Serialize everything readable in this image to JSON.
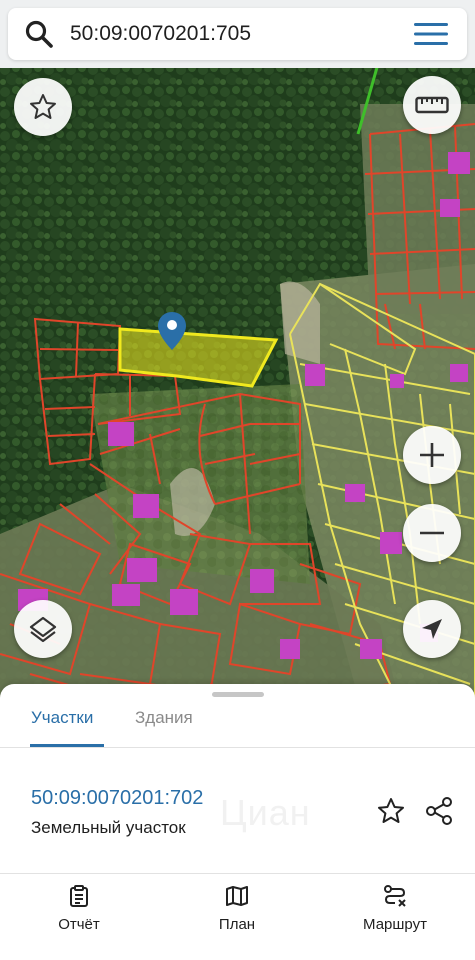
{
  "search": {
    "value": "50:09:0070201:705",
    "icon": "search-icon",
    "menu_icon": "hamburger-menu-icon"
  },
  "map": {
    "controls": [
      "star-icon",
      "ruler-icon",
      "zoom-in-icon",
      "zoom-out-icon",
      "layers-icon",
      "location-arrow-icon",
      "map-pin-icon"
    ],
    "colors": {
      "parcel_border": "#e0452a",
      "selected_parcel_fill": "#f0e91e",
      "neighbor_parcel_border": "#e8e25a",
      "building_fill": "#c443c4",
      "control_button": "#ffffff",
      "pin": "#2a6fa8"
    }
  },
  "sheet": {
    "tabs": [
      {
        "label": "Участки",
        "active": true
      },
      {
        "label": "Здания",
        "active": false
      }
    ],
    "parcel": {
      "id": "50:09:0070201:702",
      "type": "Земельный участок"
    },
    "watermark": "Циан",
    "accent_color": "#2a6fa8"
  },
  "bottom_nav": [
    {
      "label": "Отчёт",
      "icon": "report-clipboard-icon"
    },
    {
      "label": "План",
      "icon": "map-plan-icon"
    },
    {
      "label": "Маршрут",
      "icon": "route-icon"
    }
  ]
}
